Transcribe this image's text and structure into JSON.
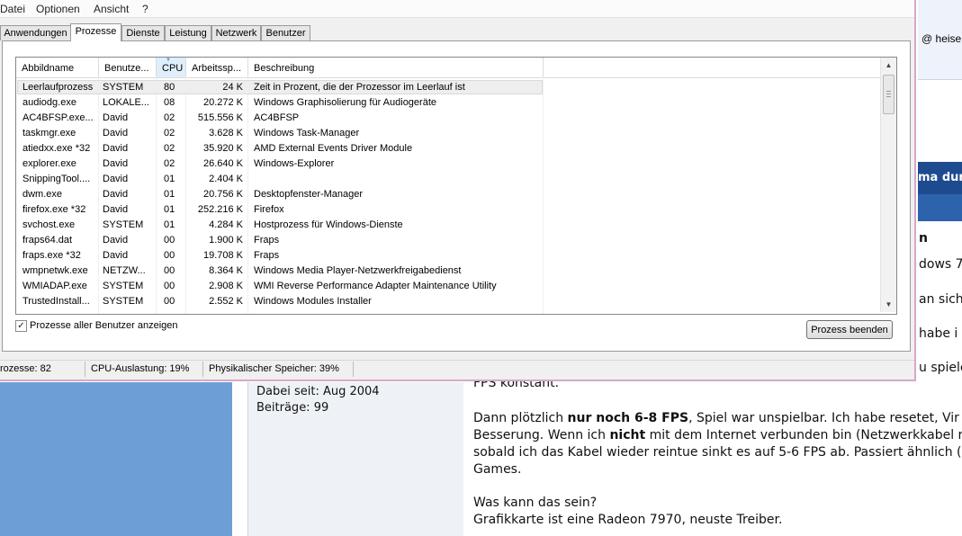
{
  "menu": [
    "Datei",
    "Optionen",
    "Ansicht",
    "?"
  ],
  "tabs": [
    "Anwendungen",
    "Prozesse",
    "Dienste",
    "Leistung",
    "Netzwerk",
    "Benutzer"
  ],
  "active_tab": "Prozesse",
  "columns": {
    "name": "Abbildname",
    "user": "Benutze...",
    "cpu": "CPU",
    "mem": "Arbeitssp...",
    "desc": "Beschreibung"
  },
  "processes": [
    {
      "name": "Leerlaufprozess",
      "user": "SYSTEM",
      "cpu": "80",
      "mem": "24 K",
      "desc": "Zeit in Prozent, die der Prozessor im Leerlauf ist"
    },
    {
      "name": "audiodg.exe",
      "user": "LOKALE...",
      "cpu": "08",
      "mem": "20.272 K",
      "desc": "Windows Graphisolierung für Audiogeräte"
    },
    {
      "name": "AC4BFSP.exe...",
      "user": "David",
      "cpu": "02",
      "mem": "515.556 K",
      "desc": "AC4BFSP"
    },
    {
      "name": "taskmgr.exe",
      "user": "David",
      "cpu": "02",
      "mem": "3.628 K",
      "desc": "Windows Task-Manager"
    },
    {
      "name": "atiedxx.exe *32",
      "user": "David",
      "cpu": "02",
      "mem": "35.920 K",
      "desc": "AMD External Events Driver Module"
    },
    {
      "name": "explorer.exe",
      "user": "David",
      "cpu": "02",
      "mem": "26.640 K",
      "desc": "Windows-Explorer"
    },
    {
      "name": "SnippingTool....",
      "user": "David",
      "cpu": "01",
      "mem": "2.404 K",
      "desc": ""
    },
    {
      "name": "dwm.exe",
      "user": "David",
      "cpu": "01",
      "mem": "20.756 K",
      "desc": "Desktopfenster-Manager"
    },
    {
      "name": "firefox.exe *32",
      "user": "David",
      "cpu": "01",
      "mem": "252.216 K",
      "desc": "Firefox"
    },
    {
      "name": "svchost.exe",
      "user": "SYSTEM",
      "cpu": "01",
      "mem": "4.284 K",
      "desc": "Hostprozess für Windows-Dienste"
    },
    {
      "name": "fraps64.dat",
      "user": "David",
      "cpu": "00",
      "mem": "1.900 K",
      "desc": "Fraps"
    },
    {
      "name": "fraps.exe *32",
      "user": "David",
      "cpu": "00",
      "mem": "19.708 K",
      "desc": "Fraps"
    },
    {
      "name": "wmpnetwk.exe",
      "user": "NETZW...",
      "cpu": "00",
      "mem": "8.364 K",
      "desc": "Windows Media Player-Netzwerkfreigabedienst"
    },
    {
      "name": "WMIADAP.exe",
      "user": "SYSTEM",
      "cpu": "00",
      "mem": "2.908 K",
      "desc": "WMI Reverse Performance Adapter Maintenance Utility"
    },
    {
      "name": "TrustedInstall...",
      "user": "SYSTEM",
      "cpu": "00",
      "mem": "2.552 K",
      "desc": "Windows Modules Installer"
    }
  ],
  "show_all_users_label": "Prozesse aller Benutzer anzeigen",
  "show_all_users_checked": true,
  "check_mark": "✓",
  "end_process_label": "Prozess beenden",
  "status": {
    "processes": "rozesse: 82",
    "cpu": "CPU-Auslastung: 19%",
    "memory": "Physikalischer Speicher: 39%"
  },
  "background": {
    "right_heading": "ma dur",
    "right_subheading": "n",
    "right_heise": "heise",
    "right_fragments": [
      "dows 7",
      "an sich",
      "habe i",
      "u spiele"
    ],
    "post_info": [
      "Dabei seit: Aug 2004",
      "Beiträge: 99"
    ],
    "post_lines": [
      {
        "segments": [
          {
            "text": "FPS konstant.",
            "bold": false
          }
        ]
      },
      {
        "segments": [
          {
            "text": "Dann plötzlich ",
            "bold": false
          },
          {
            "text": "nur noch 6-8 FPS",
            "bold": true
          },
          {
            "text": ", Spiel war unspielbar. Ich habe resetet, Vir",
            "bold": false
          }
        ]
      },
      {
        "segments": [
          {
            "text": "Besserung. Wenn ich ",
            "bold": false
          },
          {
            "text": "nicht",
            "bold": true
          },
          {
            "text": " mit dem Internet verbunden bin (Netzwerkkabel r",
            "bold": false
          }
        ]
      },
      {
        "segments": [
          {
            "text": "sobald ich das Kabel wieder reintue sinkt es auf 5-6 FPS ab. Passiert ähnlich (",
            "bold": false
          }
        ]
      },
      {
        "segments": [
          {
            "text": "Games.",
            "bold": false
          }
        ]
      },
      {
        "segments": [
          {
            "text": "Was kann das sein?",
            "bold": false
          }
        ]
      },
      {
        "segments": [
          {
            "text": "Grafikkarte ist eine Radeon 7970, neuste Treiber.",
            "bold": false
          }
        ]
      }
    ]
  }
}
